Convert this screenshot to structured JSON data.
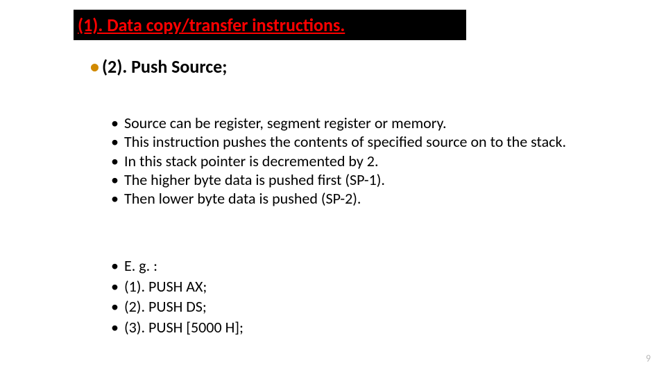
{
  "title": "(1). Data copy/transfer instructions.",
  "subhead": "(2). Push Source;",
  "body1": [
    "Source can be register, segment register or memory.",
    "This instruction pushes the contents of specified source on to the stack.",
    "In this stack pointer is decremented by 2.",
    "The higher byte data is pushed first (SP-1).",
    "Then lower byte data is pushed (SP-2)."
  ],
  "body2": [
    "E. g. :",
    "(1). PUSH AX;",
    "(2). PUSH DS;",
    "(3). PUSH [5000 H];"
  ],
  "page_number": "9"
}
